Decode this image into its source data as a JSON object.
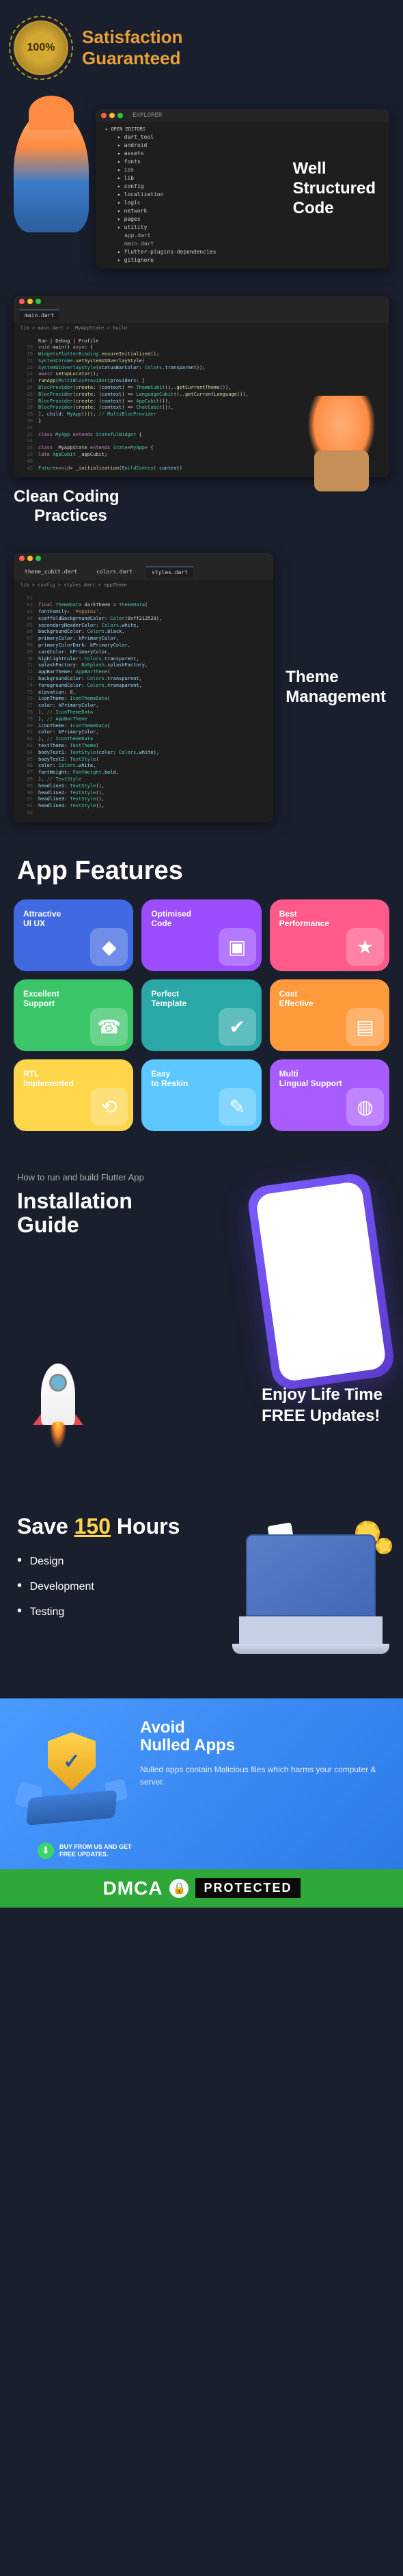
{
  "satisfaction": {
    "badge": "100%",
    "line1": "Satisfaction",
    "line2": "Guaranteed"
  },
  "sec1": {
    "label_l1": "Well",
    "label_l2": "Structured",
    "label_l3": "Code",
    "explorer": "EXPLORER",
    "open_editors": "OPEN EDITORS",
    "tree": [
      "dart_tool",
      "android",
      "assets",
      "fonts",
      "ios",
      "lib",
      "config",
      "localization",
      "logic",
      "network",
      "pages",
      "utility",
      "app.dart",
      "main.dart",
      "flutter-plugins-dependencies",
      "gitignore"
    ]
  },
  "sec2": {
    "label_l1": "Clean Coding",
    "label_l2": "Practices",
    "tab": "main.dart",
    "crumb": "lib > main.dart > _MyAppState > build",
    "lines": [
      {
        "n": "",
        "t": "Run | Debug | Profile"
      },
      {
        "n": "19",
        "t": "void main() async {"
      },
      {
        "n": "20",
        "t": "  WidgetsFlutterBinding.ensureInitialized();"
      },
      {
        "n": "21",
        "t": "  SystemChrome.setSystemUIOverlayStyle("
      },
      {
        "n": "22",
        "t": "    SystemUiOverlayStyle(statusBarColor: Colors.transparent));"
      },
      {
        "n": "23",
        "t": "  await setupLocator();"
      },
      {
        "n": "24",
        "t": "  runApp(MultiBlocProvider(providers: ["
      },
      {
        "n": "25",
        "t": "    BlocProvider(create: (context) => ThemeCubit()..getCurrentTheme()),"
      },
      {
        "n": "26",
        "t": "    BlocProvider(create: (context) => LanguageCubit()..getCurrentLanguage()),"
      },
      {
        "n": "27",
        "t": "    BlocProvider(create: (context) => AppCubit()),"
      },
      {
        "n": "28",
        "t": "    BlocProvider(create: (context) => ChatCubit()),"
      },
      {
        "n": "29",
        "t": "  ], child: MyApp())); // MultiBlocProvider"
      },
      {
        "n": "30",
        "t": "}"
      },
      {
        "n": "31",
        "t": ""
      },
      {
        "n": "32",
        "t": "class MyApp extends StatefulWidget {"
      },
      {
        "n": "34",
        "t": ""
      },
      {
        "n": "38",
        "t": "class _MyAppState extends State<MyApp> {"
      },
      {
        "n": "39",
        "t": "  late AppCubit _appCubit;"
      },
      {
        "n": "40",
        "t": ""
      },
      {
        "n": "42",
        "t": "  Future<void> _initialization(BuildContext context)"
      }
    ]
  },
  "sec3": {
    "label_l1": "Theme",
    "label_l2": "Management",
    "tabs": [
      "theme_cubit.dart",
      "colors.dart",
      "styles.dart"
    ],
    "crumb": "lib > config > styles.dart > appTheme",
    "lines": [
      {
        "n": "61",
        "t": ""
      },
      {
        "n": "62",
        "t": "final ThemeData darkTheme = ThemeData("
      },
      {
        "n": "63",
        "t": "    fontFamily: 'Poppins',"
      },
      {
        "n": "64",
        "t": "    scaffoldBackgroundColor: Color(0xff212529),"
      },
      {
        "n": "65",
        "t": "    secondaryHeaderColor: Colors.white,"
      },
      {
        "n": "66",
        "t": "    backgroundColor: Colors.black,"
      },
      {
        "n": "67",
        "t": "    primaryColor: kPrimaryColor,"
      },
      {
        "n": "68",
        "t": "    primaryColorDark: kPrimaryColor,"
      },
      {
        "n": "69",
        "t": "    cardColor: kPrimaryColor,"
      },
      {
        "n": "70",
        "t": "    highlightColor: Colors.transparent,"
      },
      {
        "n": "71",
        "t": "    splashFactory: NoSplash.splashFactory,"
      },
      {
        "n": "72",
        "t": "    appBarTheme: AppBarTheme("
      },
      {
        "n": "73",
        "t": "      backgroundColor: Colors.transparent,"
      },
      {
        "n": "74",
        "t": "      foregroundColor: Colors.transparent,"
      },
      {
        "n": "75",
        "t": "      elevation: 0,"
      },
      {
        "n": "76",
        "t": "      iconTheme: IconThemeData("
      },
      {
        "n": "77",
        "t": "        color: kPrimaryColor,"
      },
      {
        "n": "78",
        "t": "      ), // IconThemeData"
      },
      {
        "n": "79",
        "t": "    ), // AppBarTheme"
      },
      {
        "n": "80",
        "t": "    iconTheme: IconThemeData("
      },
      {
        "n": "81",
        "t": "      color: kPrimaryColor,"
      },
      {
        "n": "82",
        "t": "    ), // IconThemeData"
      },
      {
        "n": "83",
        "t": "    textTheme: TextTheme("
      },
      {
        "n": "84",
        "t": "      bodyText1: TextStyle(color: Colors.white),"
      },
      {
        "n": "85",
        "t": "      bodyText2: TextStyle("
      },
      {
        "n": "86",
        "t": "        color: Colors.white,"
      },
      {
        "n": "87",
        "t": "        fontWeight: FontWeight.bold,"
      },
      {
        "n": "88",
        "t": "      ), // TextStyle"
      },
      {
        "n": "89",
        "t": "      headline1: TextStyle(),"
      },
      {
        "n": "90",
        "t": "      headline2: TextStyle(),"
      },
      {
        "n": "91",
        "t": "      headline3: TextStyle(),"
      },
      {
        "n": "92",
        "t": "      headline4: TextStyle(),"
      },
      {
        "n": "93",
        "t": ""
      }
    ]
  },
  "features": {
    "title": "App Features",
    "cards": [
      {
        "title": "Attractive UI UX",
        "color": "#4169e1"
      },
      {
        "title": "Optimised Code",
        "color": "#9b4dff"
      },
      {
        "title": "Best Performance",
        "color": "#ff5a8a"
      },
      {
        "title": "Excellent Support",
        "color": "#3ac569"
      },
      {
        "title": "Perfect Template",
        "color": "#2aa8a8"
      },
      {
        "title": "Cost Effective",
        "color": "#ff9a3d"
      },
      {
        "title": "RTL Implemented",
        "color": "#ffd54a"
      },
      {
        "title": "Easy to Reskin",
        "color": "#5cc8ff"
      },
      {
        "title": "Multi Lingual Support",
        "color": "#a85cff"
      }
    ]
  },
  "install": {
    "subtitle": "How to run and build Flutter App",
    "title_l1": "Installation",
    "title_l2": "Guide"
  },
  "updates": {
    "line1": "Enjoy Life Time",
    "line2": "FREE Updates!"
  },
  "save": {
    "prefix": "Save ",
    "hours": "150",
    "suffix": " Hours",
    "items": [
      "Design",
      "Development",
      "Testing"
    ]
  },
  "avoid": {
    "title_l1": "Avoid",
    "title_l2": "Nulled Apps",
    "desc": "Nulled apps contain Malicious files which harms your computer & server.",
    "buy_l1": "BUY FROM US AND GET",
    "buy_l2": "FREE UPDATES."
  },
  "dmca": {
    "brand": "DMCA",
    "protected": "PROTECTED"
  }
}
